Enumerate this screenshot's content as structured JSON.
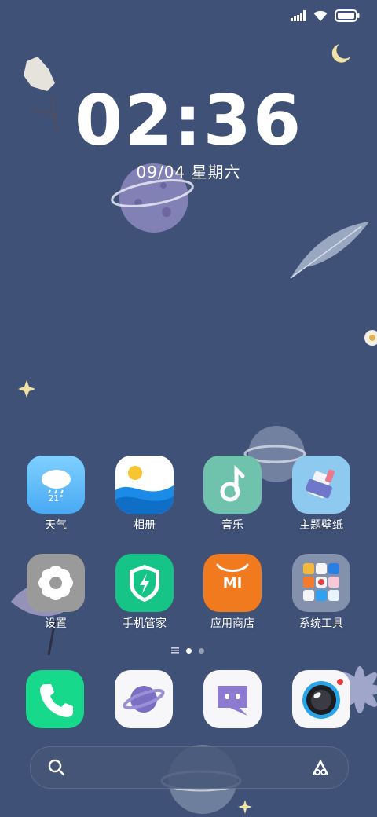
{
  "lockscreen": {
    "time": "02:36",
    "date": "09/04 星期六"
  },
  "status_bar": {
    "icons": [
      "signal-icon",
      "wifi-icon",
      "battery-icon"
    ]
  },
  "apps": [
    {
      "label": "天气",
      "icon": "weather-icon",
      "temp": "21°"
    },
    {
      "label": "相册",
      "icon": "gallery-icon"
    },
    {
      "label": "音乐",
      "icon": "music-icon"
    },
    {
      "label": "主题壁纸",
      "icon": "themes-icon"
    },
    {
      "label": "设置",
      "icon": "settings-icon"
    },
    {
      "label": "手机管家",
      "icon": "security-icon"
    },
    {
      "label": "应用商店",
      "icon": "app-store-icon",
      "mark": "MI"
    },
    {
      "label": "系统工具",
      "icon": "tools-folder-icon"
    }
  ],
  "page_indicator": {
    "pages": 2,
    "current": 1
  },
  "dock": [
    {
      "icon": "phone-icon"
    },
    {
      "icon": "browser-icon"
    },
    {
      "icon": "messages-icon"
    },
    {
      "icon": "camera-icon"
    }
  ],
  "search_bar": {
    "icons": [
      "search-icon",
      "assistant-icon"
    ]
  },
  "colors": {
    "wallpaper": "#3f5176",
    "dock_tile": "#f7f7f9",
    "accent_green": "#16d98c"
  }
}
